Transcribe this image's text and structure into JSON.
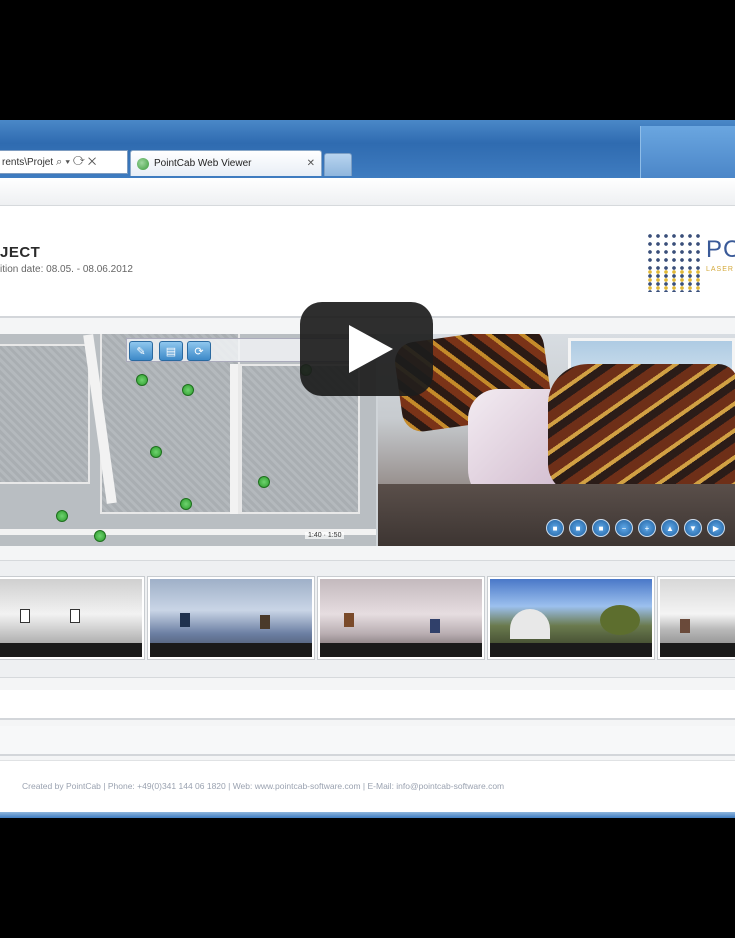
{
  "browser": {
    "address_text": "rents\\Projet",
    "address_icons": "⌕ ▾ ⟳ ✕",
    "tab_title": "PointCab Web Viewer",
    "tab_close": "✕"
  },
  "header": {
    "project_title": "JECT",
    "project_date": "ition date: 08.05. - 08.06.2012",
    "logo_text": "PC",
    "logo_sub": "LASER"
  },
  "map": {
    "tool_icons": [
      "pencil-icon",
      "layers-icon",
      "refresh-icon"
    ],
    "scale_label": "1:40 · 1:50"
  },
  "pano": {
    "controls": [
      "pano-btn-1",
      "pano-btn-2",
      "pano-btn-3",
      "pano-btn-4",
      "pano-btn-5",
      "pano-btn-6",
      "pano-btn-7",
      "pano-btn-8"
    ]
  },
  "thumbnails": [
    "thumb-1",
    "thumb-2",
    "thumb-3",
    "thumb-4",
    "thumb-5"
  ],
  "footer": {
    "text": "Created by PointCab | Phone: +49(0)341 144 06 1820 | Web: www.pointcab-software.com | E-Mail: info@pointcab-software.com"
  },
  "colors": {
    "chrome_blue": "#2f6bb0",
    "logo_blue": "#3a5a98",
    "logo_gold": "#e0b83a",
    "marker_green": "#2c9c2c"
  }
}
